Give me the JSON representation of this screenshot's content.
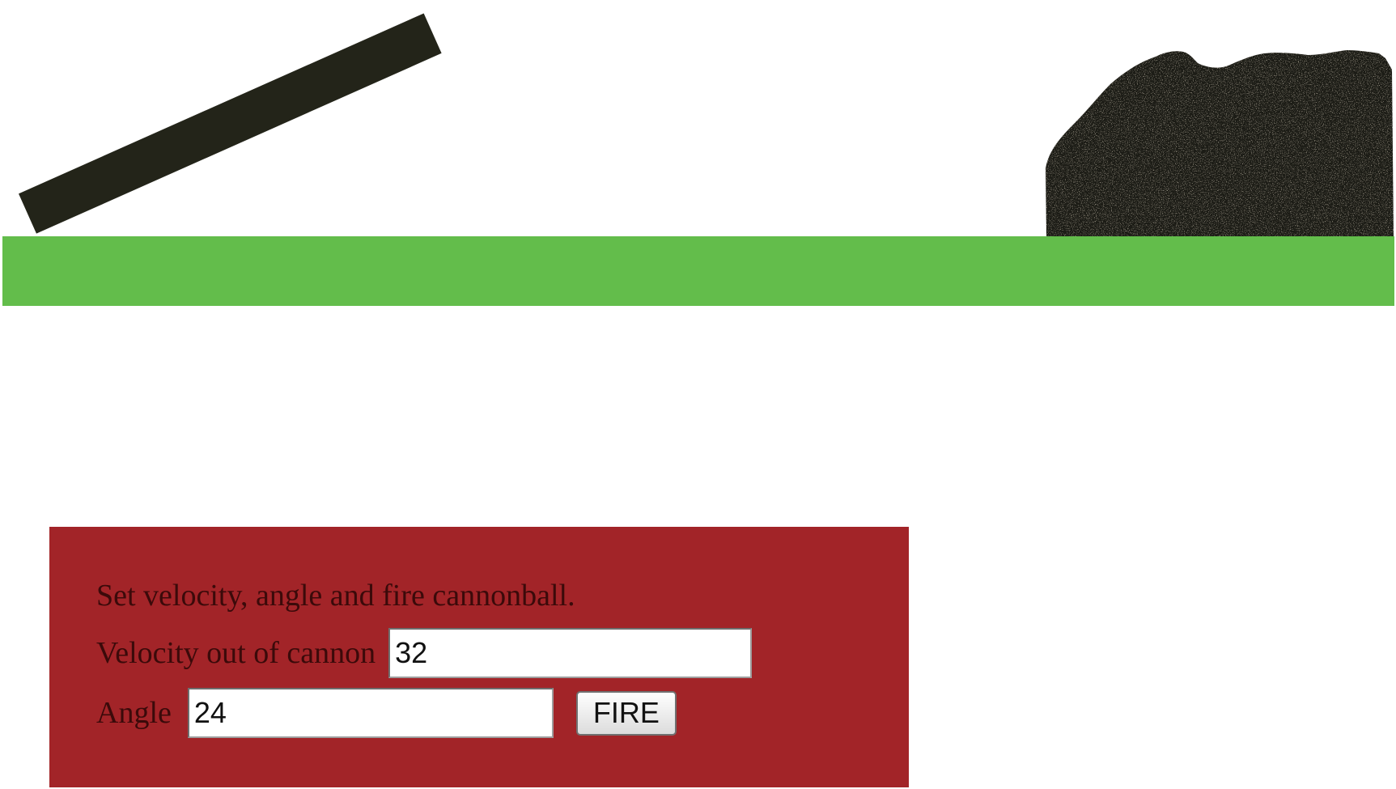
{
  "game": {
    "colors": {
      "background": "#ffffff",
      "ground": "#63bd4b",
      "cannon": "#232419",
      "target": "#1f1d16",
      "panel": "#a22428",
      "label_text": "#3b0a0a"
    },
    "cannon_angle_degrees": 24
  },
  "panel": {
    "instructions": "Set velocity, angle and fire cannonball.",
    "velocity_label": "Velocity out of cannon",
    "velocity_value": "32",
    "angle_label": "Angle",
    "angle_value": "24",
    "fire_label": "FIRE"
  }
}
